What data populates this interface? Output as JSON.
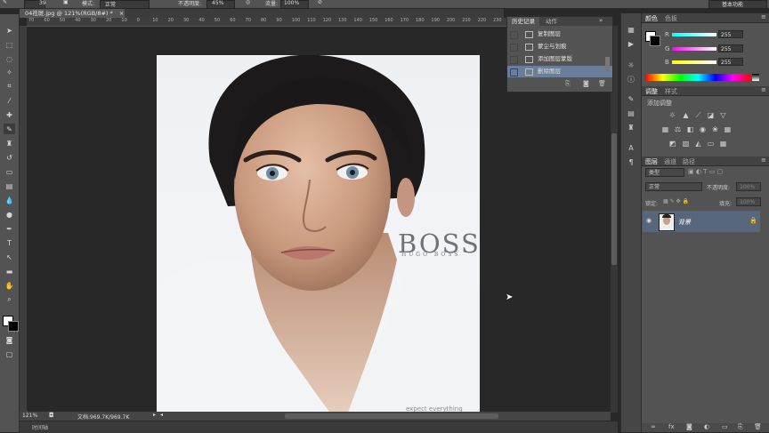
{
  "options_bar": {
    "size": "39",
    "mode_label": "模式:",
    "mode_value": "正常",
    "opacity_label": "不透明度:",
    "opacity_value": "45%",
    "flow_label": "流量:",
    "flow_value": "100%",
    "workspace": "基本功能"
  },
  "document": {
    "tab_title": "04祛斑.jpg @ 121%(RGB/8#) *",
    "close_glyph": "×",
    "ruler_marks": [
      "70",
      "60",
      "50",
      "40",
      "30",
      "20",
      "10",
      "0",
      "10",
      "20",
      "30",
      "40",
      "50",
      "60",
      "70",
      "80",
      "90",
      "100",
      "110",
      "120",
      "130",
      "140",
      "150",
      "160",
      "170",
      "180",
      "190",
      "200",
      "210",
      "220",
      "230",
      "240",
      "250",
      "260",
      "270",
      "280",
      "290",
      "300"
    ]
  },
  "image": {
    "brand": "BOSS",
    "sub_brand": "HUGO BOSS",
    "tagline": "expect everything"
  },
  "status_bar": {
    "zoom": "121%",
    "doc_info": "文档:969.7K/969.7K"
  },
  "timeline": {
    "label": "时间轴"
  },
  "history_panel": {
    "tabs": [
      "历史记录",
      "动作"
    ],
    "items": [
      "复制图层",
      "蒙尘与划痕",
      "添加图层蒙版",
      "删除图层"
    ],
    "selected_index": 3
  },
  "color_panel": {
    "tabs": [
      "颜色",
      "色板"
    ],
    "channels": [
      {
        "name": "R",
        "value": "255"
      },
      {
        "name": "G",
        "value": "255"
      },
      {
        "name": "B",
        "value": "255"
      }
    ]
  },
  "adjustments_panel": {
    "tabs": [
      "调整",
      "样式"
    ],
    "title": "添加调整"
  },
  "layers_panel": {
    "tabs": [
      "图层",
      "通道",
      "路径"
    ],
    "filter_kind": "类型",
    "blend_mode": "正常",
    "opacity_label": "不透明度:",
    "opacity_value": "100%",
    "lock_label": "锁定:",
    "fill_label": "填充:",
    "fill_value": "100%",
    "layers": [
      {
        "name": "背景",
        "locked": true
      }
    ]
  },
  "colors": {
    "selected_history": "#6a7e9a",
    "layer_selected": "#58667b",
    "r_slider_start": "#00ffff",
    "r_slider_end": "#ffffff"
  }
}
